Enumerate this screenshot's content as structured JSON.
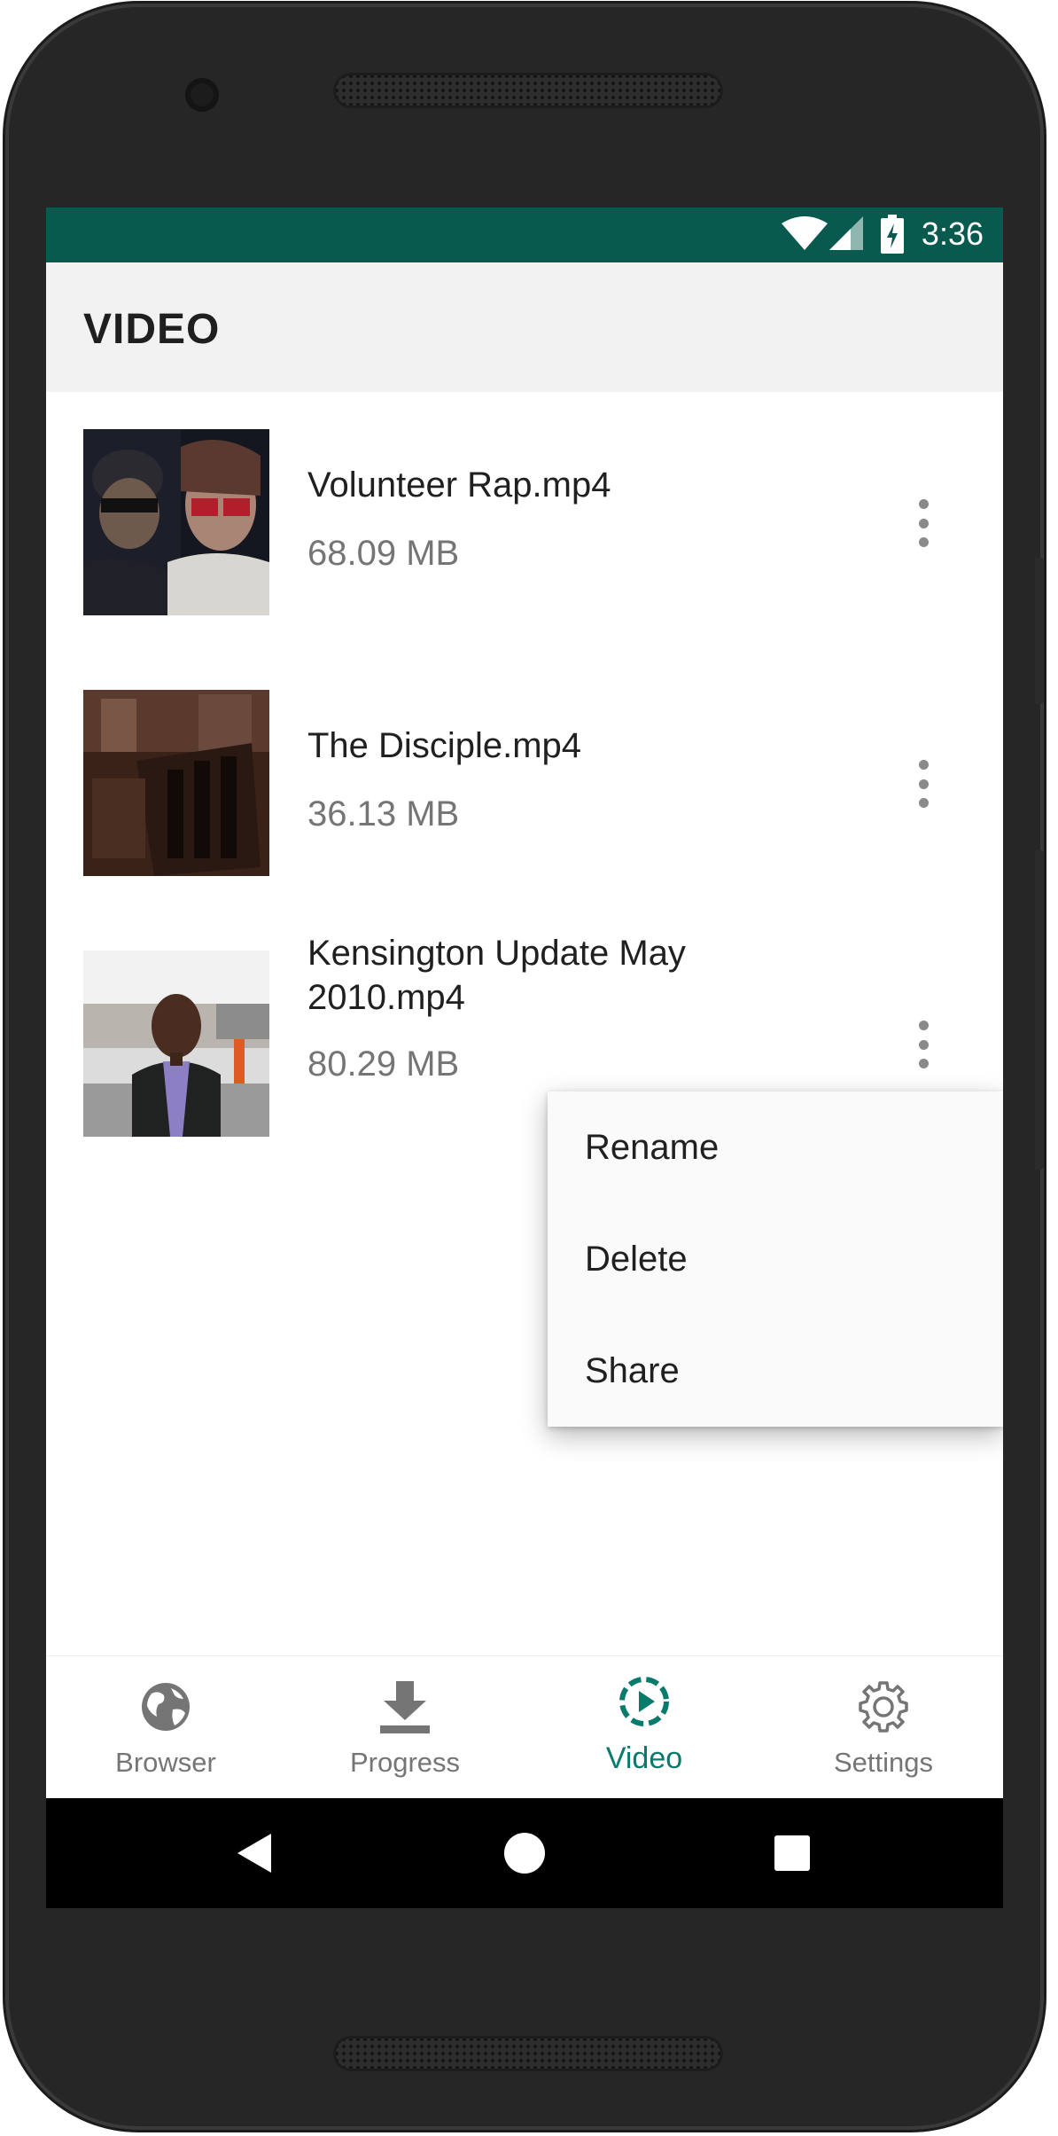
{
  "status_bar": {
    "time": "3:36"
  },
  "app_bar": {
    "title": "VIDEO"
  },
  "videos": [
    {
      "title": "Volunteer Rap.mp4",
      "size": "68.09 MB"
    },
    {
      "title": "The Disciple.mp4",
      "size": "36.13 MB"
    },
    {
      "title": "Kensington Update May 2010.mp4",
      "size": "80.29 MB"
    }
  ],
  "popup_menu": {
    "items": [
      "Rename",
      "Delete",
      "Share"
    ]
  },
  "bottom_nav": {
    "items": [
      {
        "label": "Browser",
        "icon": "globe-icon",
        "active": false
      },
      {
        "label": "Progress",
        "icon": "download-icon",
        "active": false
      },
      {
        "label": "Video",
        "icon": "play-circle-icon",
        "active": true
      },
      {
        "label": "Settings",
        "icon": "gear-icon",
        "active": false
      }
    ]
  },
  "colors": {
    "status_bar": "#075a4d",
    "accent": "#0a7a6c",
    "app_bar": "#f2f2f2"
  }
}
